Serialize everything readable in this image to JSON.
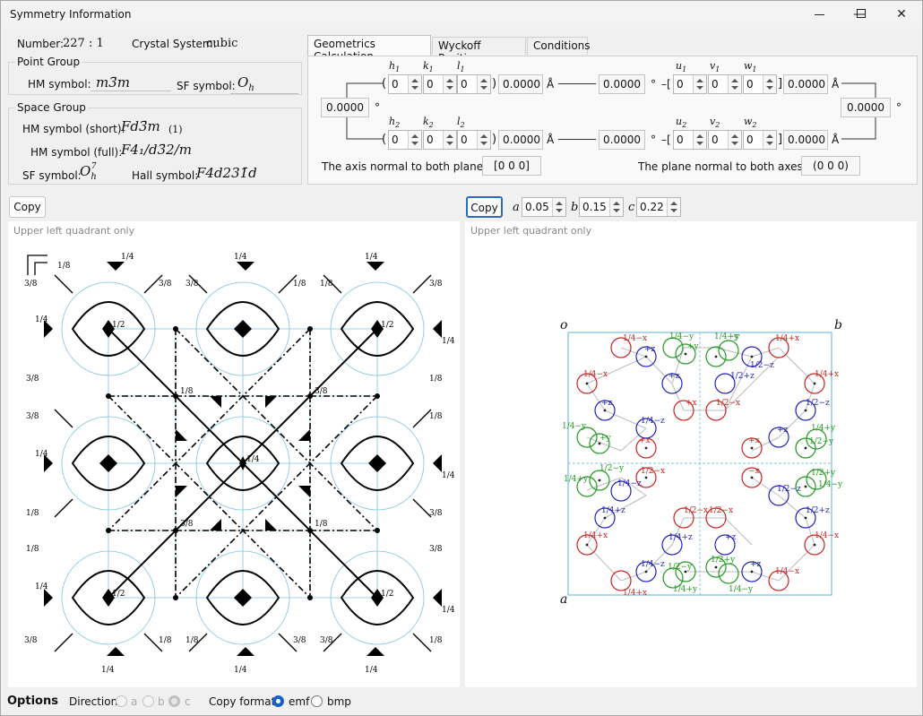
{
  "window": {
    "title": "Symmetry Information",
    "controls": {
      "minimize": "—",
      "maximize": "☐",
      "close": "✕"
    }
  },
  "number": {
    "label": "Number:",
    "value": "227 : 1"
  },
  "crystal_system": {
    "label": "Crystal System:",
    "value": "cubic"
  },
  "point_group": {
    "title": "Point Group",
    "hm_label": "HM symbol:",
    "hm_value": "m3̄m",
    "sf_label": "SF symbol:",
    "sf_value": "Oh"
  },
  "space_group": {
    "title": "Space Group",
    "hm_short_label": "HM symbol (short):",
    "hm_short_value": "Fd3̄m",
    "hm_short_suffix": "(1)",
    "hm_full_label": "HM symbol (full):",
    "hm_full_value": "F4₁/d3̄2/m",
    "sf_label": "SF symbol:",
    "sf_value": "Oh7",
    "hall_label": "Hall symbol:",
    "hall_value": "F4d231̄d"
  },
  "tabs": [
    "Geometrics Calculation",
    "Wyckoff Positions",
    "Conditions"
  ],
  "geometrics": {
    "row1": {
      "labels": [
        "h1",
        "k1",
        "l1",
        "u1",
        "v1",
        "w1"
      ],
      "h": "0",
      "k": "0",
      "l": "0",
      "d_value": "0.0000",
      "d_unit": "Å",
      "angle": "0.0000",
      "angle_unit": "°",
      "u": "0",
      "v": "0",
      "w": "0",
      "len_value": "0.0000",
      "len_unit": "Å"
    },
    "row2": {
      "labels": [
        "h2",
        "k2",
        "l2",
        "u2",
        "v2",
        "w2"
      ],
      "h": "0",
      "k": "0",
      "l": "0",
      "d_value": "0.0000",
      "d_unit": "Å",
      "angle": "0.0000",
      "angle_unit": "°",
      "u": "0",
      "v": "0",
      "w": "0",
      "len_value": "0.0000",
      "len_unit": "Å"
    },
    "left_angle": "0.0000",
    "left_angle_unit": "°",
    "right_angle": "0.0000",
    "right_angle_unit": "°",
    "axis_normal_label": "The axis normal to both planes",
    "axis_normal_value": "[0 0 0]",
    "plane_normal_label": "The plane normal to both axes",
    "plane_normal_value": "(0 0 0)"
  },
  "left_panel": {
    "copy_label": "Copy",
    "hint": "Upper left quadrant only"
  },
  "right_panel": {
    "copy_label": "Copy",
    "hint": "Upper left quadrant only",
    "a_label": "a",
    "a_value": "0.05",
    "b_label": "b",
    "b_value": "0.15",
    "c_label": "c",
    "c_value": "0.22",
    "origin": "o",
    "axis_b": "b",
    "axis_a": "a"
  },
  "options": {
    "title": "Options",
    "direction_label": "Direction",
    "dir_a": "a",
    "dir_b": "b",
    "dir_c": "c",
    "copy_format_label": "Copy format",
    "emf": "emf",
    "bmp": "bmp"
  },
  "colors": {
    "red": "#cc2222",
    "blue": "#2222bb",
    "green": "#229922",
    "cyan": "#5ab4d6"
  }
}
